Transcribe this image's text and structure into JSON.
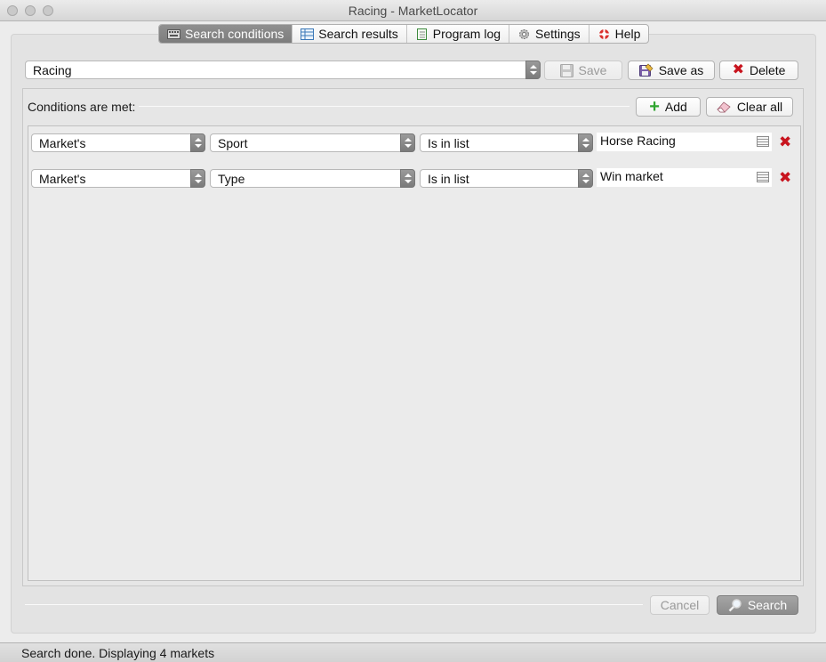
{
  "window": {
    "title": "Racing - MarketLocator"
  },
  "tabs": [
    {
      "label": "Search conditions",
      "active": true
    },
    {
      "label": "Search results"
    },
    {
      "label": "Program log"
    },
    {
      "label": "Settings"
    },
    {
      "label": "Help"
    }
  ],
  "profile": {
    "selected": "Racing",
    "save_label": "Save",
    "save_as_label": "Save as",
    "delete_label": "Delete"
  },
  "conditions": {
    "header": "Conditions are met:",
    "add_label": "Add",
    "clear_label": "Clear all",
    "rows": [
      {
        "subject": "Market's",
        "field": "Sport",
        "operator": "Is in list",
        "value": "Horse Racing"
      },
      {
        "subject": "Market's",
        "field": "Type",
        "operator": "Is in list",
        "value": "Win market"
      }
    ]
  },
  "footer": {
    "cancel_label": "Cancel",
    "search_label": "Search"
  },
  "status": {
    "text": "Search done. Displaying 4 markets"
  },
  "colors": {
    "delete_red": "#c8141e",
    "add_green": "#2fa52f",
    "active_tab": "#858585"
  }
}
